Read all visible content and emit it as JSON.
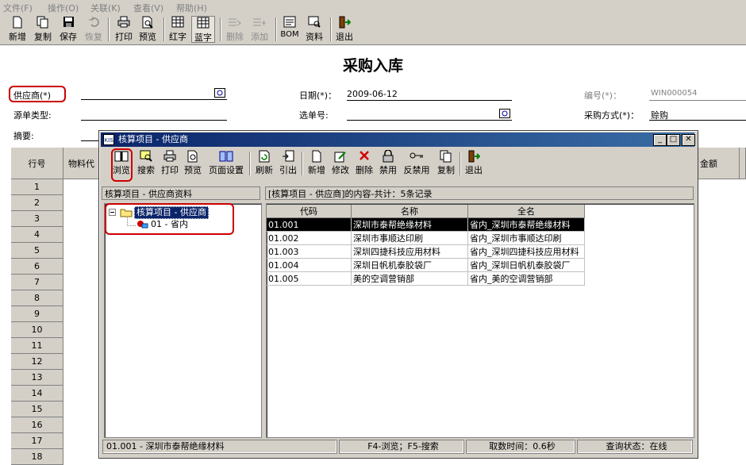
{
  "menubar": {
    "items": [
      "文件(F)",
      "操作(O)",
      "关联(K)",
      "查看(V)",
      "帮助(H)"
    ]
  },
  "toolbar": {
    "buttons": [
      {
        "label": "新增",
        "icon": "new-doc-icon",
        "enabled": true
      },
      {
        "label": "复制",
        "icon": "copy-icon",
        "enabled": true
      },
      {
        "label": "保存",
        "icon": "save-icon",
        "enabled": true
      },
      {
        "label": "恢复",
        "icon": "undo-icon",
        "enabled": false
      },
      {
        "label": "打印",
        "icon": "print-icon",
        "enabled": true
      },
      {
        "label": "预览",
        "icon": "preview-icon",
        "enabled": true
      },
      {
        "label": "红字",
        "icon": "red-grid-icon",
        "enabled": true
      },
      {
        "label": "蓝字",
        "icon": "blue-grid-icon",
        "enabled": true,
        "pressed": true
      },
      {
        "label": "删除",
        "icon": "delete-row-icon",
        "enabled": false
      },
      {
        "label": "添加",
        "icon": "add-row-icon",
        "enabled": false
      },
      {
        "label": "BOM",
        "icon": "bom-icon",
        "enabled": true
      },
      {
        "label": "资料",
        "icon": "data-icon",
        "enabled": true
      },
      {
        "label": "退出",
        "icon": "exit-icon",
        "enabled": true
      }
    ]
  },
  "form": {
    "title": "采购入库",
    "supplier_label": "供应商(*)",
    "supplier_value": "",
    "date_label": "日期(*)：",
    "date_value": "2009-06-12",
    "number_label": "编号(*)：",
    "number_value": "WIN000054",
    "source_type_label": "源单类型:",
    "select_no_label": "选单号:",
    "purchase_method_label": "采购方式(*)：",
    "purchase_method_value": "赊购",
    "summary_label": "摘要:"
  },
  "grid": {
    "headers": {
      "row_no": "行号",
      "material": "物料代",
      "amount": "金额"
    },
    "rows": [
      "1",
      "2",
      "3",
      "4",
      "5",
      "6",
      "7",
      "8",
      "9",
      "10",
      "11",
      "12",
      "13",
      "14",
      "15",
      "16",
      "17",
      "18"
    ]
  },
  "dialog": {
    "title": "核算项目 - 供应商",
    "toolbar": [
      {
        "label": "浏览",
        "icon": "browse-book-icon"
      },
      {
        "label": "搜索",
        "icon": "search-icon"
      },
      {
        "label": "打印",
        "icon": "print-icon"
      },
      {
        "label": "预览",
        "icon": "preview-icon"
      },
      {
        "label": "页面设置",
        "icon": "page-setup-icon"
      },
      {
        "label": "刷新",
        "icon": "refresh-icon"
      },
      {
        "label": "引出",
        "icon": "export-icon"
      },
      {
        "label": "新增",
        "icon": "new-doc-icon"
      },
      {
        "label": "修改",
        "icon": "edit-icon"
      },
      {
        "label": "删除",
        "icon": "delete-x-icon"
      },
      {
        "label": "禁用",
        "icon": "lock-icon"
      },
      {
        "label": "反禁用",
        "icon": "key-icon"
      },
      {
        "label": "复制",
        "icon": "copy-icon"
      },
      {
        "label": "退出",
        "icon": "exit-icon"
      }
    ],
    "left_panel_title": "核算项目 - 供应商资料",
    "tree": {
      "root": "核算项目 - 供应商",
      "child": "01 - 省内"
    },
    "right_panel_title": "[核算项目 - 供应商]的内容-共计：5条记录",
    "table": {
      "columns": [
        "代码",
        "名称",
        "全名"
      ],
      "rows": [
        [
          "01.001",
          "深圳市泰帮绝缘材料",
          "省内_深圳市泰帮绝缘材料"
        ],
        [
          "01.002",
          "深圳市事顺达印刷",
          "省内_深圳市事顺达印刷"
        ],
        [
          "01.003",
          "深圳四捷科技应用材料",
          "省内_深圳四捷科技应用材料"
        ],
        [
          "01.004",
          "深圳日帆机泰胶袋厂",
          "省内_深圳日帆机泰胶袋厂"
        ],
        [
          "01.005",
          "美的空调营销部",
          "省内_美的空调营销部"
        ]
      ]
    },
    "status": {
      "current": "01.001 - 深圳市泰帮绝缘材料",
      "hint": "F4-浏览；F5-搜索",
      "fetch_time": "取数时间：0.6秒",
      "query_state": "查询状态：在线"
    }
  },
  "colors": {
    "title_bar": "#0a246a",
    "chrome": "#d4d0c8",
    "highlight": "#cc0000"
  }
}
